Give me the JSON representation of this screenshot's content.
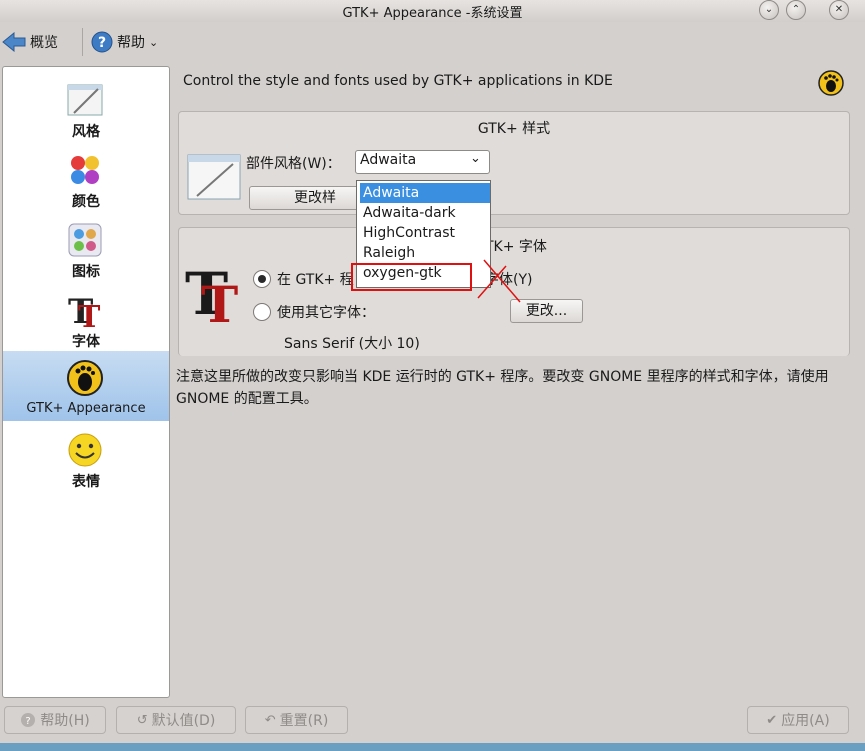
{
  "window": {
    "title": "GTK+ Appearance -系统设置"
  },
  "toolbar": {
    "overview": "概览",
    "help": "帮助"
  },
  "sidebar": {
    "items": [
      {
        "label": "风格",
        "icon": "window-style-icon"
      },
      {
        "label": "颜色",
        "icon": "color-palette-icon"
      },
      {
        "label": "图标",
        "icon": "icons-icon"
      },
      {
        "label": "字体",
        "icon": "font-icon"
      },
      {
        "label": "GTK+ Appearance",
        "icon": "gnome-foot-icon",
        "selected": true
      },
      {
        "label": "表情",
        "icon": "smiley-icon"
      }
    ]
  },
  "main": {
    "header": "Control the style and fonts used by GTK+ applications in KDE",
    "style_group": {
      "title": "GTK+ 样式",
      "widget_style_label": "部件风格(W)：",
      "widget_style_value": "Adwaita",
      "change_button": "更改样"
    },
    "dropdown": {
      "options": [
        "Adwaita",
        "Adwaita-dark",
        "HighContrast",
        "Raleigh",
        "oxygen-gtk"
      ],
      "selected": "Adwaita",
      "highlighted_note": "oxygen-gtk"
    },
    "font_group": {
      "title": "TK+ 字体",
      "option_gtk": "在 GTK+ 程",
      "option_gtk_tail": "字体(Y)",
      "option_other": "使用其它字体：",
      "change_button": "更改...",
      "font_desc": "Sans Serif (大小 10)"
    },
    "note": "注意这里所做的改变只影响当 KDE 运行时的 GTK+ 程序。要改变 GNOME 里程序的样式和字体，请使用 GNOME 的配置工具。"
  },
  "bottom": {
    "help": "帮助(H)",
    "defaults": "默认值(D)",
    "reset": "重置(R)",
    "apply": "应用(A)"
  },
  "colors": {
    "selection": "#3a8fe0",
    "sidebar_selected": "#a9c9ec",
    "annotation": "#e01010"
  }
}
